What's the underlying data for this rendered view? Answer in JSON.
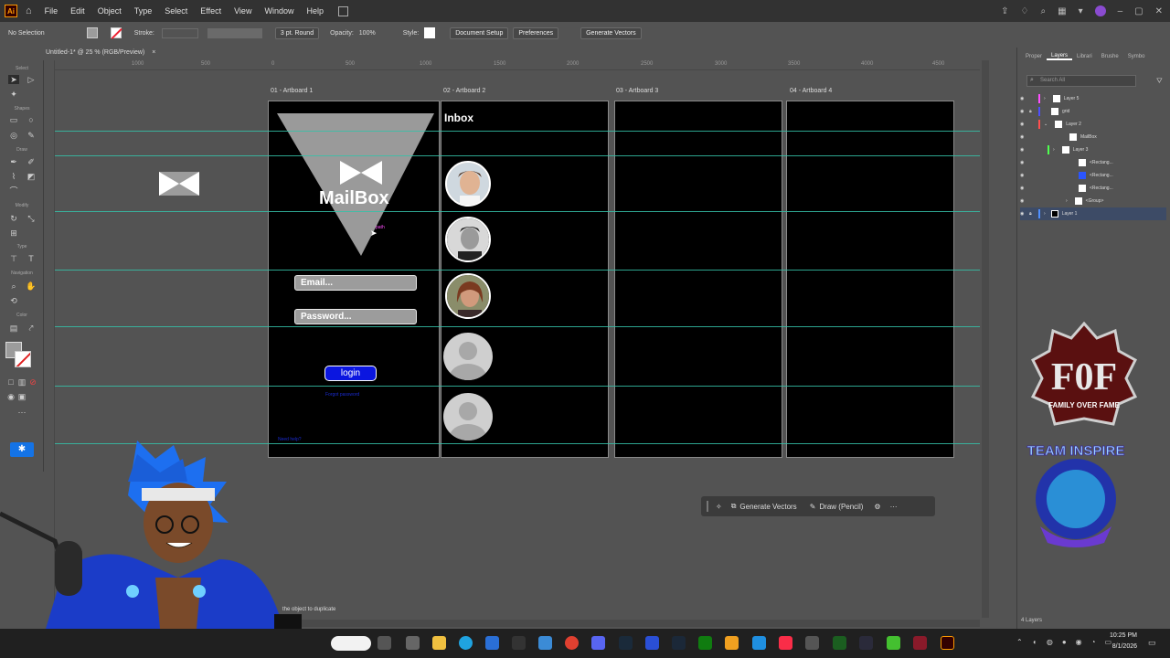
{
  "app": {
    "logo": "Ai",
    "doc_tab": "Untitled-1* @ 25 % (RGB/Preview)",
    "doc_tab_close": "×"
  },
  "menu": [
    "File",
    "Edit",
    "Object",
    "Type",
    "Select",
    "Effect",
    "View",
    "Window",
    "Help"
  ],
  "control_bar": {
    "selection": "No Selection",
    "stroke_label": "Stroke:",
    "brush": "3 pt. Round",
    "opacity_label": "Opacity:",
    "opacity_value": "100%",
    "style_label": "Style:",
    "document_setup": "Document Setup",
    "preferences": "Preferences",
    "generate_vectors": "Generate Vectors"
  },
  "toolbar_groups": [
    "Select",
    "Shapes",
    "Draw",
    "Modify",
    "Type",
    "Navigation",
    "Color"
  ],
  "ruler_ticks": [
    "1000",
    "500",
    "0",
    "500",
    "1000",
    "1500",
    "2000",
    "2500",
    "3000",
    "3500",
    "4000",
    "4500"
  ],
  "artboards": [
    {
      "label": "01 - Artboard 1"
    },
    {
      "label": "02 - Artboard 2"
    },
    {
      "label": "03 - Artboard 3"
    },
    {
      "label": "04 - Artboard 4"
    }
  ],
  "artboard1": {
    "brand": "MailBox",
    "email_placeholder": "Email...",
    "password_placeholder": "Password...",
    "login": "login",
    "forgot": "Forgot password",
    "need_help": "Need help?",
    "cursor_label": "path"
  },
  "artboard2": {
    "title": "Inbox"
  },
  "floating_bar": {
    "generate_vectors": "Generate Vectors",
    "draw": "Draw (Pencil)",
    "more": "···"
  },
  "status_hint": "the object to duplicate",
  "panel": {
    "tabs": [
      "Proper",
      "Layers",
      "Librari",
      "Brushe",
      "Symbo"
    ],
    "active_tab": "Layers",
    "search_placeholder": "Search All",
    "layers": [
      {
        "name": "Layer 5",
        "color": "#ff4fff"
      },
      {
        "name": "grid",
        "color": "#4f4fff"
      },
      {
        "name": "Layer 2",
        "color": "#ff4f4f"
      },
      {
        "name": "MailBox",
        "color": "#ff4f4f"
      },
      {
        "name": "Layer 3",
        "color": "#4fff4f"
      },
      {
        "name": "<Rectang...",
        "color": "#4fff4f"
      },
      {
        "name": "<Rectang...",
        "color": "#4fff4f"
      },
      {
        "name": "<Rectang...",
        "color": "#4fff4f"
      },
      {
        "name": "<Group>",
        "color": "#4fff4f"
      },
      {
        "name": "Layer 1",
        "color": "#4f8fff"
      }
    ],
    "footer": "4 Layers"
  },
  "overlay_logos": {
    "fof_top": "F0F",
    "fof_sub": "FAMILY OVER FAME",
    "team": "TEAM INSPIRE"
  },
  "taskbar": {
    "time": "10:25 PM",
    "date": "8/1/2026"
  },
  "colors": {
    "accent_blue": "#0b16e0",
    "guide": "#35c1a8",
    "artboard": "#000000"
  }
}
